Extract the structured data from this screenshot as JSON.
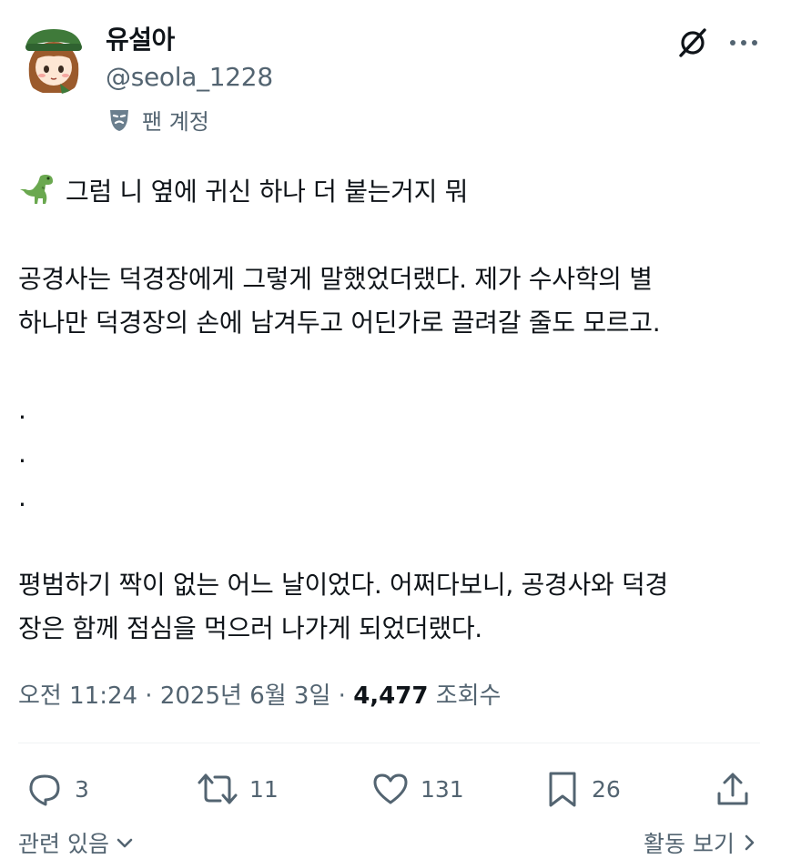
{
  "author": {
    "display_name": "유설아",
    "handle": "@seola_1228",
    "badge_text": "팬 계정",
    "avatar_icon": "avatar-girl-green-hat-icon"
  },
  "header_icons": {
    "grok": "grok-icon",
    "more": "more-options-icon"
  },
  "tweet": {
    "paragraphs": [
      {
        "emoji": "dinosaur-icon",
        "text": "그럼 니 옆에 귀신 하나 더 붙는거지 뭐"
      },
      {
        "text": ""
      },
      {
        "text": "공경사는 덕경장에게 그렇게 말했었더랬다. 제가 수사학의 별"
      },
      {
        "text": "하나만 덕경장의 손에 남겨두고 어딘가로 끌려갈 줄도 모르고."
      },
      {
        "text": ""
      },
      {
        "text": "."
      },
      {
        "text": "."
      },
      {
        "text": "."
      },
      {
        "text": ""
      },
      {
        "text": "평범하기 짝이 없는 어느 날이었다. 어쩌다보니, 공경사와 덕경"
      },
      {
        "text": "장은 함께 점심을 먹으러 나가게 되었더랬다."
      }
    ]
  },
  "meta": {
    "time": "오전 11:24",
    "sep1": " · ",
    "date": "2025년 6월 3일",
    "sep2": " · ",
    "views": "4,477",
    "views_label": " 조회수"
  },
  "actions": {
    "replies": "3",
    "retweets": "11",
    "likes": "131",
    "bookmarks": "26"
  },
  "footer": {
    "related": "관련 있음",
    "activity": "활동 보기"
  },
  "colors": {
    "text": "#0f1419",
    "secondary": "#536471",
    "divider": "#eff3f4"
  }
}
